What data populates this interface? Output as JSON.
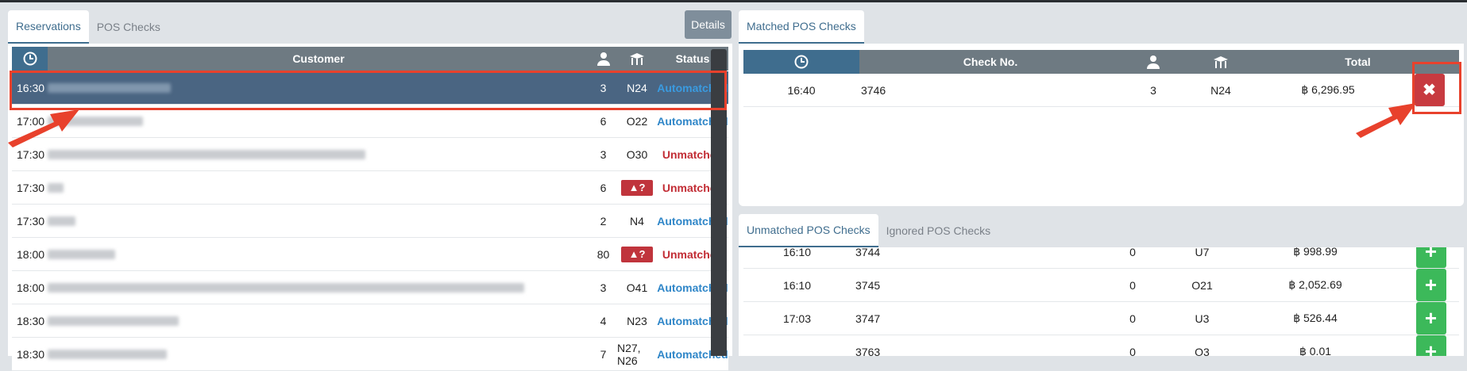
{
  "left_panel": {
    "tabs": [
      {
        "label": "Reservations",
        "active": true
      },
      {
        "label": "POS Checks",
        "active": false
      }
    ],
    "details_label": "Details",
    "columns": {
      "time_icon": "clock-icon",
      "customer": "Customer",
      "guests_icon": "person-icon",
      "table_icon": "table-icon",
      "status": "Status"
    },
    "rows": [
      {
        "time": "16:30",
        "guests": "3",
        "table": "N24",
        "status": "Automatched",
        "status_type": "auto",
        "selected": true
      },
      {
        "time": "17:00",
        "guests": "6",
        "table": "O22",
        "status": "Automatched",
        "status_type": "auto"
      },
      {
        "time": "17:30",
        "guests": "3",
        "table": "O30",
        "status": "Unmatched",
        "status_type": "unmatched"
      },
      {
        "time": "17:30",
        "guests": "6",
        "table": "",
        "table_unknown": "?",
        "status": "Unmatched",
        "status_type": "unmatched"
      },
      {
        "time": "17:30",
        "guests": "2",
        "table": "N4",
        "status": "Automatched",
        "status_type": "auto"
      },
      {
        "time": "18:00",
        "guests": "80",
        "table": "",
        "table_unknown": "?",
        "status": "Unmatched",
        "status_type": "unmatched"
      },
      {
        "time": "18:00",
        "guests": "3",
        "table": "O41",
        "status": "Automatched",
        "status_type": "auto"
      },
      {
        "time": "18:30",
        "guests": "4",
        "table": "N23",
        "status": "Automatched",
        "status_type": "auto"
      },
      {
        "time": "18:30",
        "guests": "7",
        "table": "N27, N26",
        "status": "Automatched",
        "status_type": "auto"
      }
    ]
  },
  "matched_panel": {
    "tab_label": "Matched POS Checks",
    "columns": {
      "time_icon": "clock-icon",
      "check_no": "Check No.",
      "guests_icon": "person-icon",
      "table_icon": "table-icon",
      "total": "Total"
    },
    "rows": [
      {
        "time": "16:40",
        "check_no": "3746",
        "guests": "3",
        "table": "N24",
        "total": "฿ 6,296.95",
        "action": "✖"
      }
    ]
  },
  "unmatched_panel": {
    "tabs": [
      {
        "label": "Unmatched POS Checks",
        "active": true
      },
      {
        "label": "Ignored POS Checks",
        "active": false
      }
    ],
    "rows": [
      {
        "time": "16:10",
        "check_no": "3744",
        "guests": "0",
        "table": "U7",
        "total": "฿ 998.99",
        "action": "+"
      },
      {
        "time": "16:10",
        "check_no": "3745",
        "guests": "0",
        "table": "O21",
        "total": "฿ 2,052.69",
        "action": "+"
      },
      {
        "time": "17:03",
        "check_no": "3747",
        "guests": "0",
        "table": "U3",
        "total": "฿ 526.44",
        "action": "+"
      },
      {
        "time": "",
        "check_no": "3763",
        "guests": "0",
        "table": "O3",
        "total": "฿ 0.01",
        "action": "+"
      }
    ]
  },
  "colors": {
    "accent": "#3f6d8e",
    "header": "#6e7a82",
    "automatched": "#2f86c8",
    "unmatched": "#c22d35",
    "highlight": "#e8412c"
  }
}
